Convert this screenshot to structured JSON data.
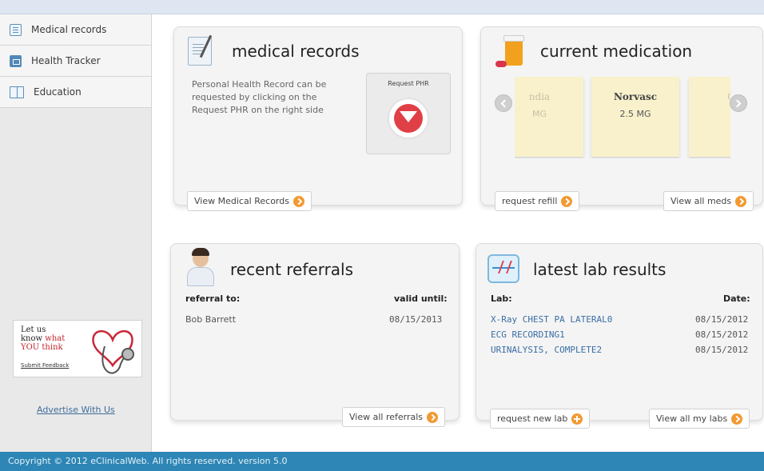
{
  "sidebar": {
    "items": [
      {
        "label": "Medical records",
        "icon": "clipboard-icon"
      },
      {
        "label": "Health Tracker",
        "icon": "tracker-icon"
      },
      {
        "label": "Education",
        "icon": "book-icon"
      }
    ],
    "feedback": {
      "line1": "Let us",
      "line2a": "know ",
      "line2b": "what",
      "line3": "YOU think",
      "link": "Submit Feedback"
    },
    "advertise": "Advertise With Us"
  },
  "medical_records": {
    "title": "medical records",
    "description": "Personal Health Record can be requested by clicking on the Request PHR on the right side",
    "request_label": "Request PHR",
    "view_button": "View Medical Records"
  },
  "current_medication": {
    "title": "current medication",
    "meds": [
      {
        "name": "ndia",
        "dose": "MG"
      },
      {
        "name": "Norvasc",
        "dose": "2.5 MG"
      },
      {
        "name": "Gl",
        "dose": ""
      }
    ],
    "refill_button": "request refill",
    "view_all_button": "View all meds"
  },
  "recent_referrals": {
    "title": "recent referrals",
    "header_left": "referral to:",
    "header_right": "valid until:",
    "rows": [
      {
        "name": "Bob Barrett",
        "date": "08/15/2013"
      }
    ],
    "view_button": "View all referrals"
  },
  "lab_results": {
    "title": "latest lab results",
    "header_left": "Lab:",
    "header_right": "Date:",
    "rows": [
      {
        "name": "X-Ray CHEST PA LATERAL0",
        "date": "08/15/2012"
      },
      {
        "name": "ECG RECORDING1",
        "date": "08/15/2012"
      },
      {
        "name": "URINALYSIS, COMPLETE2",
        "date": "08/15/2012"
      }
    ],
    "new_lab_button": "request new lab",
    "view_all_button": "View all my labs"
  },
  "footer": {
    "text": "Copyright © 2012 eClinicalWeb. All rights reserved. version 5.0"
  },
  "colors": {
    "accent_orange": "#f29a32",
    "footer_blue": "#2d86b5",
    "link_blue": "#3a6ea5",
    "download_red": "#e04045"
  }
}
